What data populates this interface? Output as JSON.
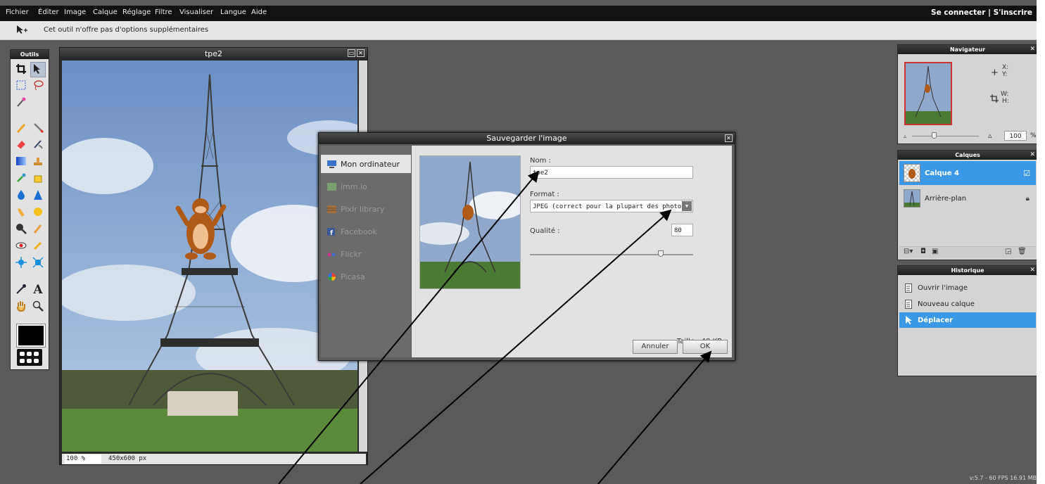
{
  "menubar": {
    "items": [
      "Fichier",
      "Éditer",
      "Image",
      "Calque",
      "Réglage",
      "Filtre",
      "Visualiser",
      "Langue",
      "Aide"
    ],
    "login": "Se connecter  |  S'inscrire"
  },
  "options_bar": {
    "text": "Cet outil n'offre pas d'options supplémentaires",
    "tool_icon": "move-tool-icon"
  },
  "tools_panel": {
    "title": "Outils",
    "selected_tool": "move-tool",
    "foreground_color": "#000000"
  },
  "document": {
    "title": "tpe2",
    "zoom": "100 %",
    "dimensions": "450x600 px"
  },
  "save_dialog": {
    "title": "Sauvegarder l'image",
    "destinations": [
      {
        "label": "Mon ordinateur",
        "icon": "computer-icon"
      },
      {
        "label": "imm.io",
        "icon": "imm-io-icon"
      },
      {
        "label": "Pixlr library",
        "icon": "library-icon"
      },
      {
        "label": "Facebook",
        "icon": "facebook-icon"
      },
      {
        "label": "Flickr",
        "icon": "flickr-icon"
      },
      {
        "label": "Picasa",
        "icon": "picasa-icon"
      }
    ],
    "active_destination": "Mon ordinateur",
    "name_label": "Nom :",
    "name_value": "tpe2",
    "format_label": "Format :",
    "format_value": "JPEG (correct pour la plupart des photos)",
    "quality_label": "Qualité :",
    "quality_value": "80",
    "quality_fraction": 0.8,
    "size_label": "Taille : 48 KB",
    "cancel_label": "Annuler",
    "ok_label": "OK"
  },
  "navigator": {
    "title": "Navigateur",
    "x_label": "X:",
    "y_label": "Y:",
    "w_label": "W:",
    "h_label": "H:",
    "zoom_value": "100",
    "zoom_unit": "%"
  },
  "layers": {
    "title": "Calques",
    "items": [
      {
        "name": "Calque 4",
        "selected": true
      },
      {
        "name": "Arrière-plan",
        "selected": false
      }
    ]
  },
  "history": {
    "title": "Historique",
    "items": [
      {
        "label": "Ouvrir l'image",
        "selected": false
      },
      {
        "label": "Nouveau calque",
        "selected": false
      },
      {
        "label": "Déplacer",
        "selected": true
      }
    ]
  },
  "version": "v:5.7 - 60 FPS 16.91 MB",
  "colors": {
    "selection_blue": "#3b98e6",
    "panel_bg": "#d4d4d4",
    "workspace": "#5a5a5a",
    "menubar": "#111111"
  }
}
